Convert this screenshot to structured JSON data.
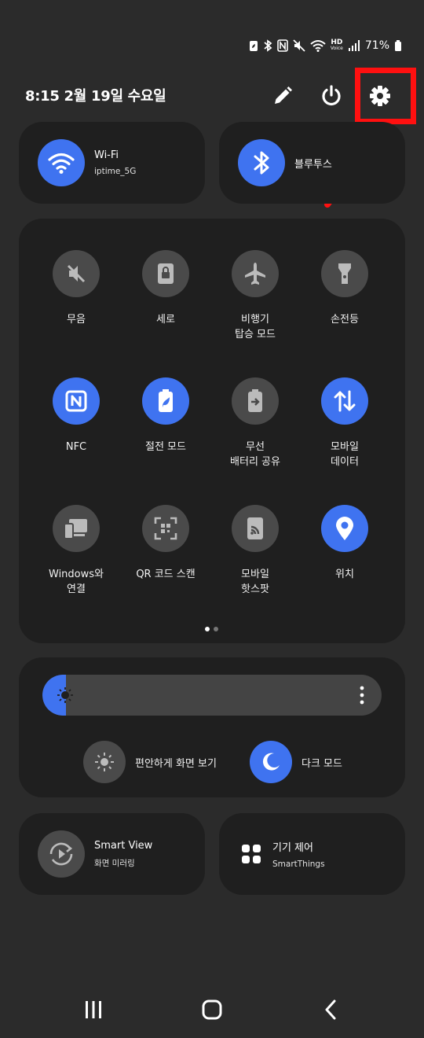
{
  "status": {
    "battery_percent": "71%",
    "hd_label": "HD",
    "voice_label": "Voice"
  },
  "header": {
    "datetime": "8:15  2월 19일 수요일"
  },
  "top_tiles": {
    "wifi": {
      "title": "Wi-Fi",
      "subtitle": "iptime_5G"
    },
    "bluetooth": {
      "title": "블루투스"
    }
  },
  "quick_tiles": [
    {
      "label": "무음",
      "icon": "mute-icon",
      "active": false
    },
    {
      "label": "세로",
      "icon": "portrait-lock-icon",
      "active": false
    },
    {
      "label": "비행기\n탑승 모드",
      "icon": "airplane-icon",
      "active": false
    },
    {
      "label": "손전등",
      "icon": "flashlight-icon",
      "active": false
    },
    {
      "label": "NFC",
      "icon": "nfc-icon",
      "active": true
    },
    {
      "label": "절전 모드",
      "icon": "power-saving-icon",
      "active": true
    },
    {
      "label": "무선\n배터리 공유",
      "icon": "wireless-powershare-icon",
      "active": false
    },
    {
      "label": "모바일\n데이터",
      "icon": "mobile-data-icon",
      "active": true
    },
    {
      "label": "Windows와\n연결",
      "icon": "link-windows-icon",
      "active": false
    },
    {
      "label": "QR 코드 스캔",
      "icon": "qr-scan-icon",
      "active": false
    },
    {
      "label": "모바일\n핫스팟",
      "icon": "hotspot-icon",
      "active": false
    },
    {
      "label": "위치",
      "icon": "location-icon",
      "active": true
    }
  ],
  "page_indicator": {
    "current": 1,
    "total": 2
  },
  "brightness": {
    "level_fraction": 0.07
  },
  "toggles": {
    "eye_comfort": "편안하게 화면 보기",
    "dark_mode": "다크 모드"
  },
  "bottom_tiles": {
    "smart_view": {
      "title": "Smart View",
      "subtitle": "화면 미러링"
    },
    "device_control": {
      "title": "기기 제어",
      "subtitle": "SmartThings"
    }
  },
  "colors": {
    "accent": "#3f73f0",
    "highlight": "#ff1010",
    "background": "#2b2b2b",
    "card": "#1f1f1f"
  }
}
